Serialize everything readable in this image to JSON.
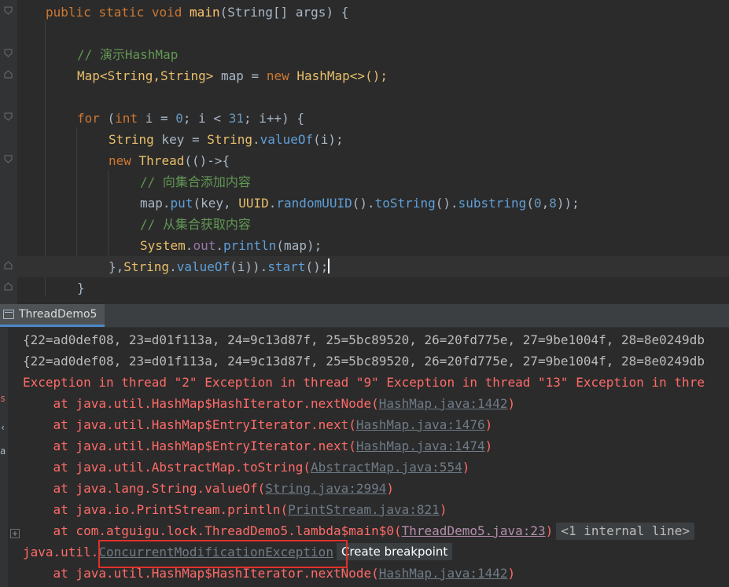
{
  "editor": {
    "lines": {
      "main_sig": {
        "kw1": "public",
        "kw2": "static",
        "kw3": "void",
        "fn": "main",
        "params": "(String[] args) {"
      },
      "comment1": "// 演示HashMap",
      "map_decl": {
        "t1": "Map<String,String>",
        "var": " map = ",
        "kw": "new",
        "t2": " HashMap<>();"
      },
      "for_line": {
        "kw1": "for",
        "p1": " (",
        "kw2": "int",
        "p2": " i = ",
        "n1": "0",
        "p3": "; i < ",
        "n2": "31",
        "p4": "; i++) {"
      },
      "key_line": {
        "t1": "String",
        "p1": " key = ",
        "t2": "String",
        "dot": ".",
        "m": "valueOf",
        "p2": "(i);"
      },
      "thread_line": {
        "kw": "new",
        "t": " Thread",
        "p": "(()->{"
      },
      "comment2": "// 向集合添加内容",
      "put_line": {
        "a": "map.",
        "m1": "put",
        "b": "(key, ",
        "t": "UUID",
        "c": ".",
        "m2": "randomUUID",
        "d": "().",
        "m3": "toString",
        "e": "().",
        "m4": "substring",
        "f": "(",
        "n1": "0",
        "g": ",",
        "n2": "8",
        "h": "));"
      },
      "comment3": "// 从集合获取内容",
      "print_line": {
        "t": "System",
        "a": ".",
        "f": "out",
        "b": ".",
        "m": "println",
        "c": "(map);"
      },
      "start_line": {
        "a": "},",
        "t": "String",
        "b": ".",
        "m1": "valueOf",
        "c": "(i)).",
        "m2": "start",
        "d": "();"
      },
      "close_brace": "}"
    }
  },
  "run_tab": {
    "label": "ThreadDemo5"
  },
  "console": {
    "out1": "{22=ad0def08, 23=d01f113a, 24=9c13d87f, 25=5bc89520, 26=20fd775e, 27=9be1004f, 28=8e0249db",
    "out2": "{22=ad0def08, 23=d01f113a, 24=9c13d87f, 25=5bc89520, 26=20fd775e, 27=9be1004f, 28=8e0249db",
    "err_header": "Exception in thread \"2\" Exception in thread \"9\" Exception in thread \"13\" Exception in thre",
    "frames": [
      {
        "prefix": "    at java.util.HashMap$HashIterator.nextNode(",
        "link": "HashMap.java:1442",
        "suffix": ")"
      },
      {
        "prefix": "    at java.util.HashMap$EntryIterator.next(",
        "link": "HashMap.java:1476",
        "suffix": ")"
      },
      {
        "prefix": "    at java.util.HashMap$EntryIterator.next(",
        "link": "HashMap.java:1474",
        "suffix": ")"
      },
      {
        "prefix": "    at java.util.AbstractMap.toString(",
        "link": "AbstractMap.java:554",
        "suffix": ")"
      },
      {
        "prefix": "    at java.lang.String.valueOf(",
        "link": "String.java:2994",
        "suffix": ")"
      },
      {
        "prefix": "    at java.io.PrintStream.println(",
        "link": "PrintStream.java:821",
        "suffix": ")"
      },
      {
        "prefix": "    at com.atguigu.lock.ThreadDemo5.lambda$main$0(",
        "link": "ThreadDemo5.java:23",
        "suffix": ")",
        "badge": "<1 internal line>"
      }
    ],
    "exc_line": {
      "prefix": "java.util.",
      "link": "ConcurrentModificationException",
      "tooltip": "Create breakpoint"
    },
    "last_frame": {
      "prefix": "    at java.util.HashMap$HashIterator.nextNode(",
      "link": "HashMap.java:1442",
      "suffix": ")"
    },
    "side_icons": [
      "s",
      "‹",
      "a"
    ]
  }
}
